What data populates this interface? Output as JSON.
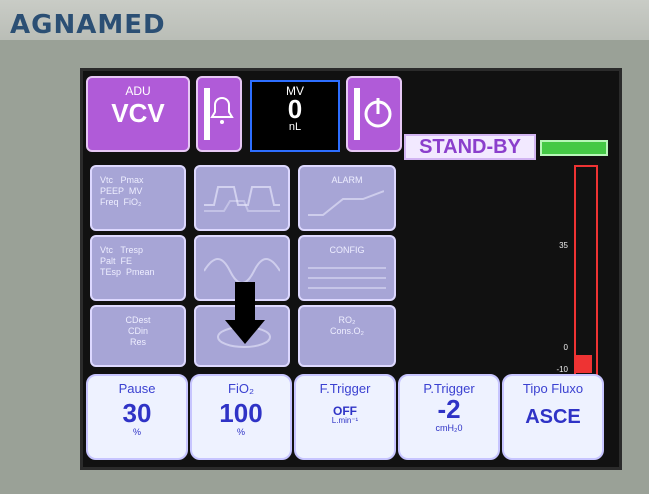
{
  "brand": "AGNAMED",
  "mode": {
    "top": "ADU",
    "main": "VCV"
  },
  "mv": {
    "label": "MV",
    "value": "0",
    "unit": "nL"
  },
  "status": "STAND-BY",
  "meter": {
    "ticks": [
      "35",
      "0",
      "-10"
    ]
  },
  "tiles": [
    {
      "text": "Vtc   Pmax\nPEEP  MV\nFreq  FiO₂"
    },
    {
      "text": ""
    },
    {
      "text": "ALARM"
    },
    {
      "text": "Vtc   Tresp\nPalt  FE\nTEsp  Pmean"
    },
    {
      "text": ""
    },
    {
      "text": "CONFIG"
    },
    {
      "text": "CDest\nCDin\nRes"
    },
    {
      "text": ""
    },
    {
      "text": "RO₂\nCons.O₂"
    }
  ],
  "bottom": [
    {
      "title": "Pause",
      "value": "30",
      "unit": "%"
    },
    {
      "title": "FiO₂",
      "value": "100",
      "unit": "%"
    },
    {
      "title": "F.Trigger",
      "value": "OFF",
      "unit": "L.min⁻¹"
    },
    {
      "title": "P.Trigger",
      "value": "-2",
      "unit": "cmH₂0"
    },
    {
      "title": "Tipo Fluxo",
      "value": "ASCE",
      "unit": ""
    }
  ]
}
